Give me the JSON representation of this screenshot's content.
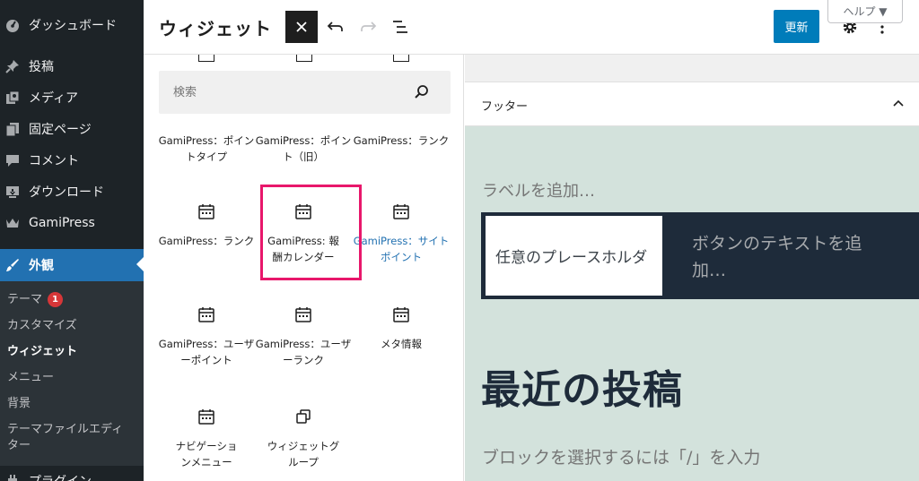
{
  "admin_menu": {
    "items": [
      {
        "label": "ダッシュボード",
        "icon": "dashboard-icon"
      },
      {
        "label": "投稿",
        "icon": "pin-icon"
      },
      {
        "label": "メディア",
        "icon": "media-icon"
      },
      {
        "label": "固定ページ",
        "icon": "pages-icon"
      },
      {
        "label": "コメント",
        "icon": "comment-icon"
      },
      {
        "label": "ダウンロード",
        "icon": "download-icon"
      },
      {
        "label": "GamiPress",
        "icon": "crown-icon"
      },
      {
        "label": "外観",
        "icon": "brush-icon"
      },
      {
        "label": "プラグイン",
        "icon": "plugin-icon"
      }
    ],
    "submenu": [
      {
        "label": "テーマ",
        "badge": "1"
      },
      {
        "label": "カスタマイズ"
      },
      {
        "label": "ウィジェット"
      },
      {
        "label": "メニュー"
      },
      {
        "label": "背景"
      },
      {
        "label": "テーマファイルエディター"
      }
    ]
  },
  "header": {
    "title": "ウィジェット",
    "update_label": "更新",
    "help_label": "ヘルプ ▼"
  },
  "inserter": {
    "search_placeholder": "検索",
    "blocks": [
      {
        "label": "GamiPress：ポイントタイプ",
        "icon": "calendar-icon"
      },
      {
        "label": "GamiPress：ポイント（旧）",
        "icon": "calendar-icon"
      },
      {
        "label": "GamiPress：ランク",
        "icon": "calendar-icon"
      },
      {
        "label": "GamiPress：ランク",
        "icon": "calendar-icon"
      },
      {
        "label": "GamiPress: 報酬カレンダー",
        "icon": "calendar-icon"
      },
      {
        "label": "GamiPress：サイトポイント",
        "icon": "calendar-icon"
      },
      {
        "label": "GamiPress：ユーザーポイント",
        "icon": "calendar-icon"
      },
      {
        "label": "GamiPress：ユーザーランク",
        "icon": "calendar-icon"
      },
      {
        "label": "メタ情報",
        "icon": "calendar-icon"
      },
      {
        "label": "ナビゲーションメニュー",
        "icon": "calendar-icon"
      },
      {
        "label": "ウィジェットグループ",
        "icon": "widget-group-icon"
      }
    ]
  },
  "canvas": {
    "area_title": "フッター",
    "search_label": "ラベルを追加…",
    "search_input_placeholder": "任意のプレースホルダ",
    "search_button_text": "ボタンのテキストを追加…",
    "recent_posts_heading": "最近の投稿",
    "block_prompt": "ブロックを選択するには「/」を入力"
  },
  "colors": {
    "sidebar_bg": "#1d2327",
    "accent": "#2271b1",
    "highlight": "#e8176b",
    "footer_bg": "#d3e2dc"
  }
}
